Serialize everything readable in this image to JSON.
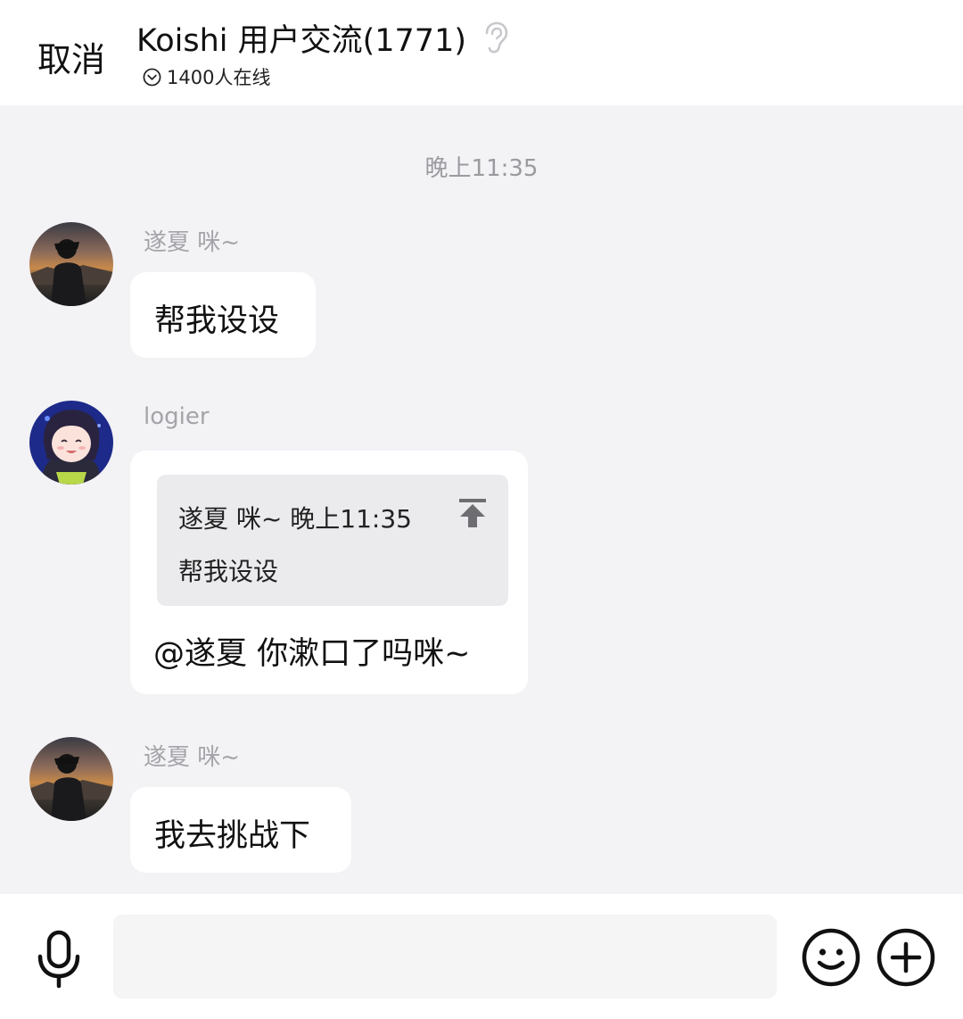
{
  "header": {
    "cancel_label": "取消",
    "title": "Koishi 用户交流(1771)",
    "online_status": "1400人在线"
  },
  "chat": {
    "timestamp": "晚上11:35",
    "messages": [
      {
        "sender": "遂夏 咪~",
        "text": "帮我设设"
      },
      {
        "sender": "logier",
        "quote": {
          "meta": "遂夏 咪~ 晚上11:35",
          "text": "帮我设设"
        },
        "text": "@遂夏  你漱口了吗咪~"
      },
      {
        "sender": "遂夏 咪~",
        "text": "我去挑战下"
      }
    ]
  },
  "input": {
    "value": "",
    "placeholder": ""
  },
  "colors": {
    "background": "#f3f2f5",
    "bubble": "#ffffff",
    "quote_background": "#ebeaed",
    "muted_text": "#a4a4a9"
  },
  "icons": [
    "ear-icon",
    "chevron-down-circle-icon",
    "pin-to-top-icon",
    "microphone-icon",
    "emoji-icon",
    "plus-circle-icon"
  ]
}
